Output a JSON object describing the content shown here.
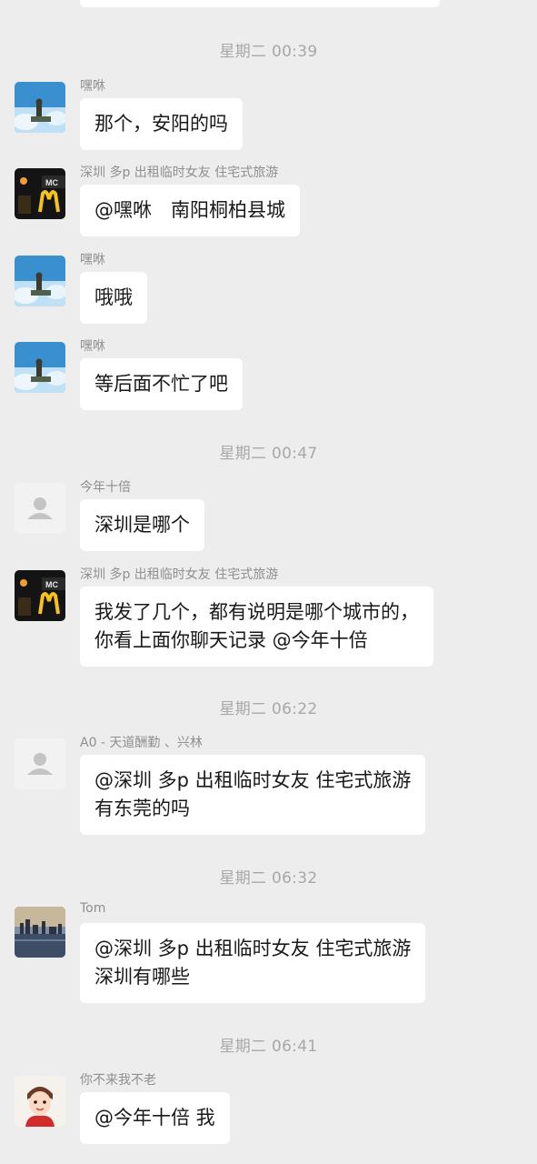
{
  "chat": {
    "timestamps": [
      "星期二 00:39",
      "星期二 00:47",
      "星期二 06:22",
      "星期二 06:32",
      "星期二 06:41"
    ],
    "messages": [
      {
        "sender": "嘿咻",
        "avatar": "sky-figure-avatar",
        "lines": [
          "那个，安阳的吗"
        ]
      },
      {
        "sender": "深圳 多p 出租临时女友 住宅式旅游",
        "avatar": "mcdonalds-avatar",
        "lines": [
          "@嘿咻　南阳桐柏县城"
        ]
      },
      {
        "sender": "嘿咻",
        "avatar": "sky-figure-avatar",
        "lines": [
          "哦哦"
        ]
      },
      {
        "sender": "嘿咻",
        "avatar": "sky-figure-avatar",
        "lines": [
          "等后面不忙了吧"
        ]
      },
      {
        "sender": "今年十倍",
        "avatar": "default-user-avatar",
        "lines": [
          "深圳是哪个"
        ]
      },
      {
        "sender": "深圳 多p 出租临时女友 住宅式旅游",
        "avatar": "mcdonalds-avatar",
        "lines": [
          "我发了几个，都有说明是哪个城市的，",
          "你看上面你聊天记录 @今年十倍"
        ]
      },
      {
        "sender": "A0 - 天道酬勤 、兴林",
        "avatar": "default-user-avatar",
        "lines": [
          "@深圳 多p 出租临时女友 住宅式旅游",
          "有东莞的吗"
        ]
      },
      {
        "sender": "Tom",
        "avatar": "city-skyline-avatar",
        "lines": [
          "@深圳 多p 出租临时女友 住宅式旅游",
          "深圳有哪些"
        ]
      },
      {
        "sender": "你不来我不老",
        "avatar": "cartoon-person-avatar",
        "lines": [
          "@今年十倍 我"
        ]
      }
    ]
  }
}
